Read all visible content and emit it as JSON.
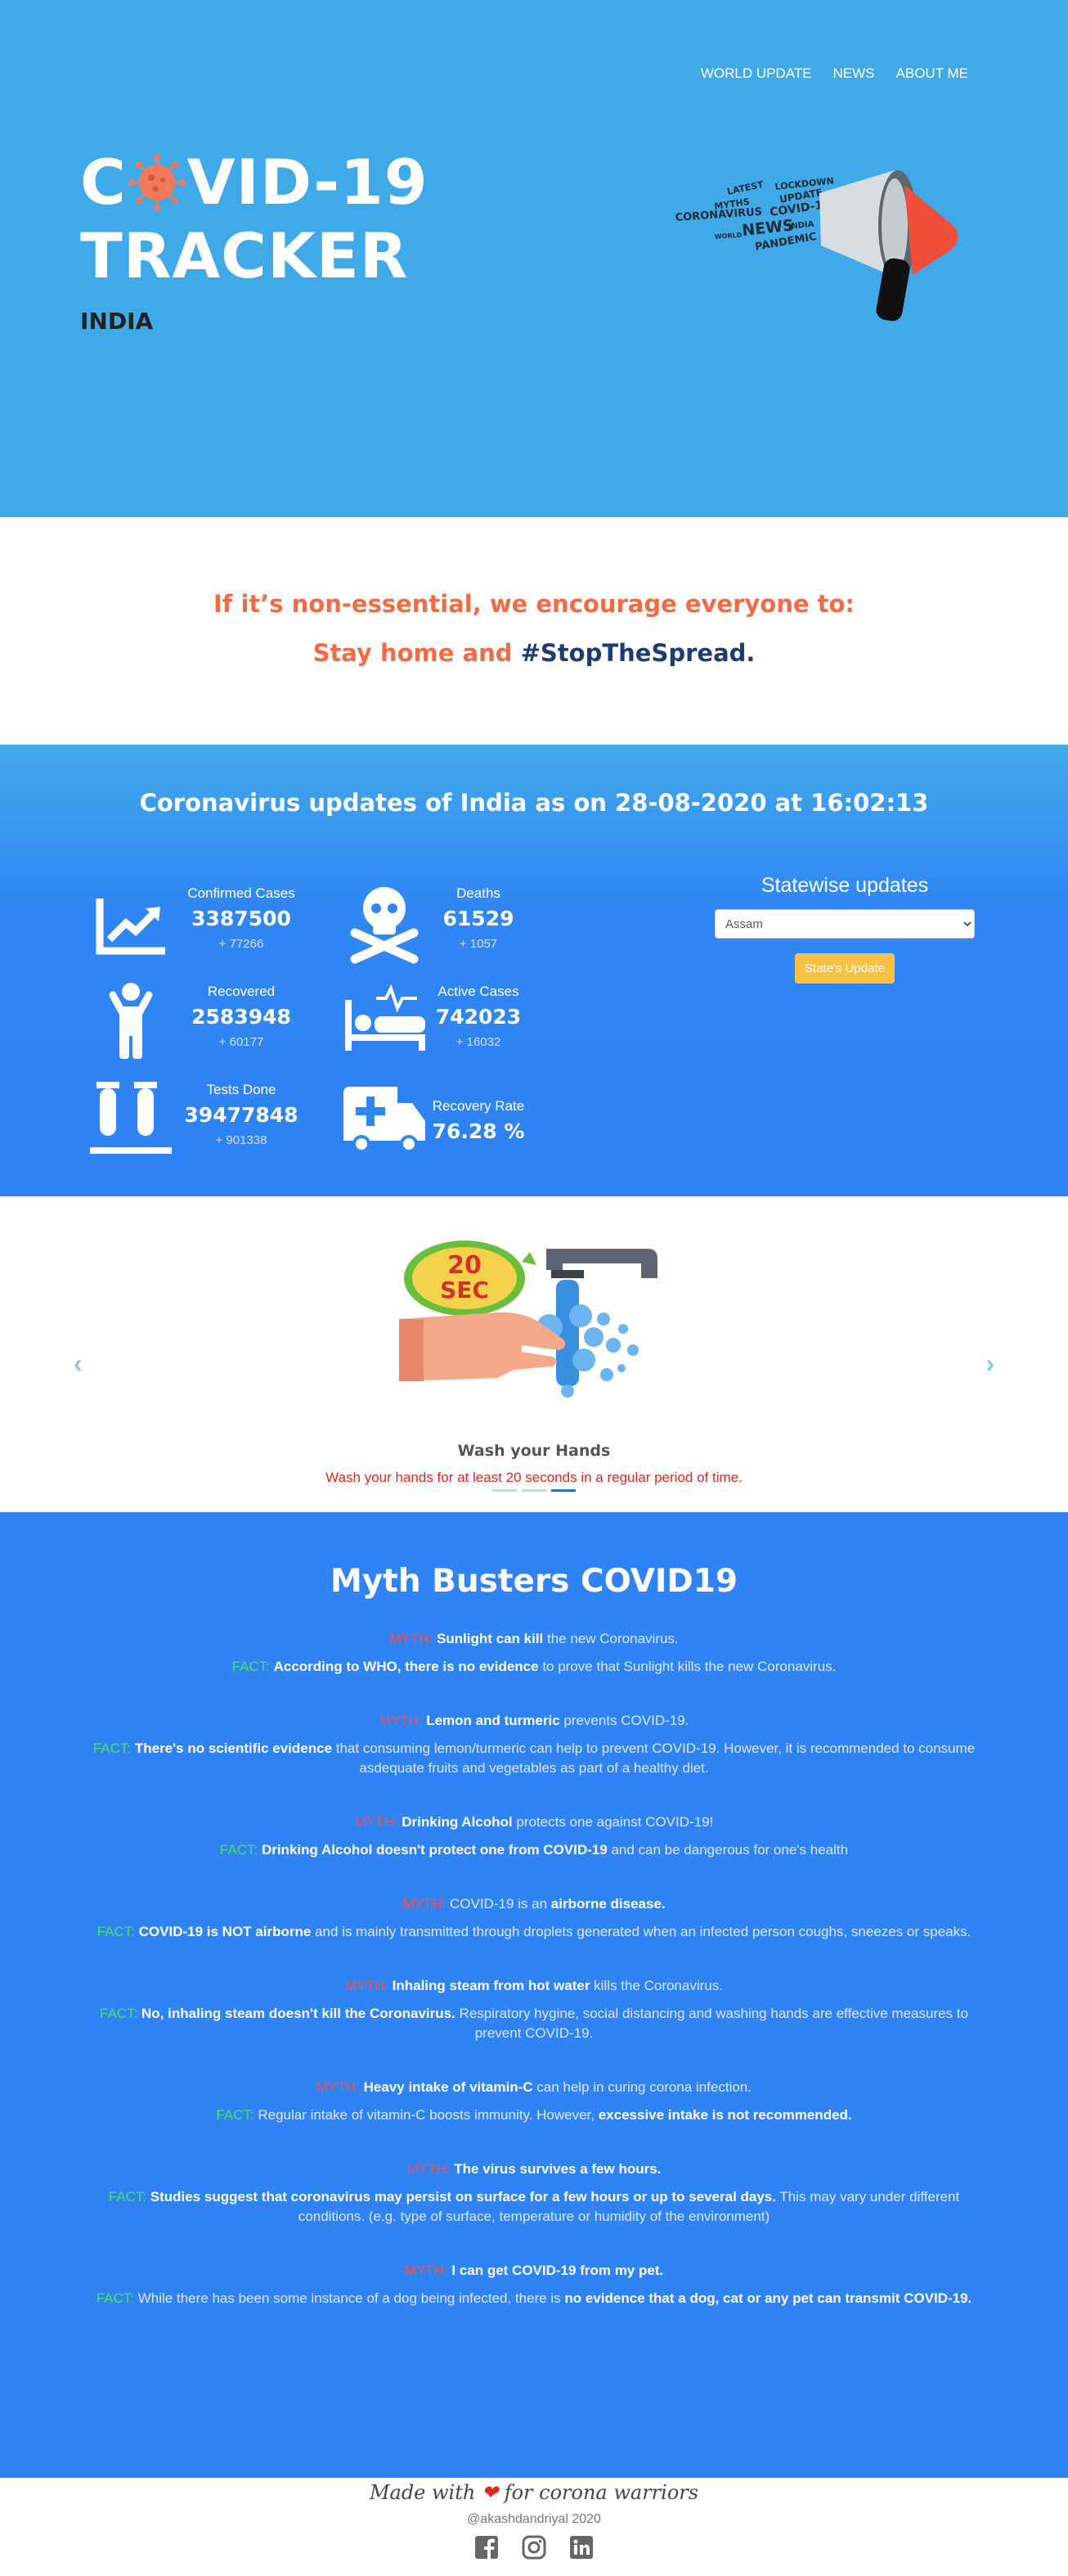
{
  "nav": {
    "items": [
      "WORLD UPDATE",
      "NEWS",
      "ABOUT ME"
    ]
  },
  "hero": {
    "title_part1": "C",
    "title_part2": "VID-19",
    "title_line2": "TRACKER",
    "country": "INDIA",
    "megaphone_words": [
      "LATEST",
      "UPDATE",
      "LOCKDOWN",
      "MYTHS",
      "COVID-19",
      "CORONAVIRUS",
      "WORLD",
      "NEWS",
      "INDIA",
      "PANDEMIC"
    ]
  },
  "message": {
    "line1": "If it’s non-essential, we encourage everyone to:",
    "line2a": "Stay home and ",
    "line2b": "#StopTheSpread."
  },
  "stats": {
    "title": "Coronavirus updates of India as on 28-08-2020 at 16:02:13",
    "confirmed": {
      "label": "Confirmed Cases",
      "value": "3387500",
      "delta": "+ 77266"
    },
    "deaths": {
      "label": "Deaths",
      "value": "61529",
      "delta": "+ 1057"
    },
    "recovered": {
      "label": "Recovered",
      "value": "2583948",
      "delta": "+ 60177"
    },
    "active": {
      "label": "Active Cases",
      "value": "742023",
      "delta": "+ 16032"
    },
    "tests": {
      "label": "Tests Done",
      "value": "39477848",
      "delta": "+ 901338"
    },
    "recovery_rate": {
      "label": "Recovery Rate",
      "value": "76.28 %"
    },
    "state_title": "Statewise updates",
    "state_selected": "Assam",
    "state_button": "State's Update"
  },
  "carousel": {
    "badge_top": "20",
    "badge_bottom": "SEC",
    "title": "Wash your Hands",
    "description": "Wash your hands for at least 20 seconds in a regular period of time.",
    "prev": "‹",
    "next": "›",
    "active_slide": 3,
    "slide_count": 3
  },
  "myths": {
    "title": "Myth Busters COVID19",
    "myth_label": "MYTH:",
    "fact_label": "FACT:",
    "items": [
      {
        "m1": "",
        "mb": "Sunlight can kill",
        "m2": " the new Coronavirus.",
        "f1": "",
        "fb": "According to WHO, there is no evidence",
        "f2": " to prove that Sunlight kills the new Coronavirus."
      },
      {
        "m1": "",
        "mb": "Lemon and turmeric",
        "m2": " prevents COVID-19.",
        "f1": "",
        "fb": "There's no scientific evidence",
        "f2": " that consuming lemon/turmeric can help to prevent COVID-19. However, it is recommended to consume asdequate fruits and vegetables as part of a healthy diet."
      },
      {
        "m1": "",
        "mb": "Drinking Alcohol",
        "m2": " protects one against COVID-19!",
        "f1": "",
        "fb": "Drinking Alcohol doesn't protect one from COVID-19",
        "f2": " and can be dangerous for one's health"
      },
      {
        "m1": "COVID-19 is an ",
        "mb": "airborne disease.",
        "m2": "",
        "f1": "",
        "fb": "COVID-19 is NOT airborne",
        "f2": " and is mainly transmitted through droplets generated when an infected person coughs, sneezes or speaks."
      },
      {
        "m1": "",
        "mb": "Inhaling steam from hot water",
        "m2": " kills the Coronavirus.",
        "f1": "",
        "fb": "No, inhaling steam doesn't kill the Coronavirus.",
        "f2": " Respiratory hygine, social distancing and washing hands are effective measures to prevent COVID-19."
      },
      {
        "m1": "",
        "mb": "Heavy intake of vitamin-C",
        "m2": " can help in curing corona infection.",
        "f1": "Regular intake of vitamin-C boosts immunity. However, ",
        "fb": "excessive intake is not recommended.",
        "f2": ""
      },
      {
        "m1": "",
        "mb": "The virus survives a few hours.",
        "m2": "",
        "f1": "",
        "fb": "Studies suggest that coronavirus may persist on surface for a few hours or up to several days.",
        "f2": " This may vary under different conditions. (e.g. type of surface, temperature or humidity of the environment)"
      },
      {
        "m1": "",
        "mb": "I can get COVID-19 from my pet.",
        "m2": "",
        "f1": "While there has been some instance of a dog being infected, there is ",
        "fb": "no evidence that a dog, cat or any pet can transmit COVID-19.",
        "f2": ""
      }
    ]
  },
  "footer": {
    "made_a": "Made with ",
    "heart": "❤",
    "made_b": " for corona warriors",
    "handle": "@akashdandriyal 2020"
  },
  "icons": [
    "virus-icon",
    "megaphone-icon",
    "chart-icon",
    "skull-icon",
    "person-icon",
    "bed-icon",
    "test-tubes-icon",
    "ambulance-icon",
    "hand-wash-image",
    "facebook-icon",
    "instagram-icon",
    "linkedin-icon"
  ],
  "colors": {
    "hero_bg": "#40aae8",
    "stats_bg": "#2f83f5",
    "accent_orange": "#f36a45",
    "accent_navy": "#1e3c72",
    "myth_red": "#ff4d4d",
    "fact_green": "#43e36b",
    "button_yellow": "#f7c244"
  }
}
